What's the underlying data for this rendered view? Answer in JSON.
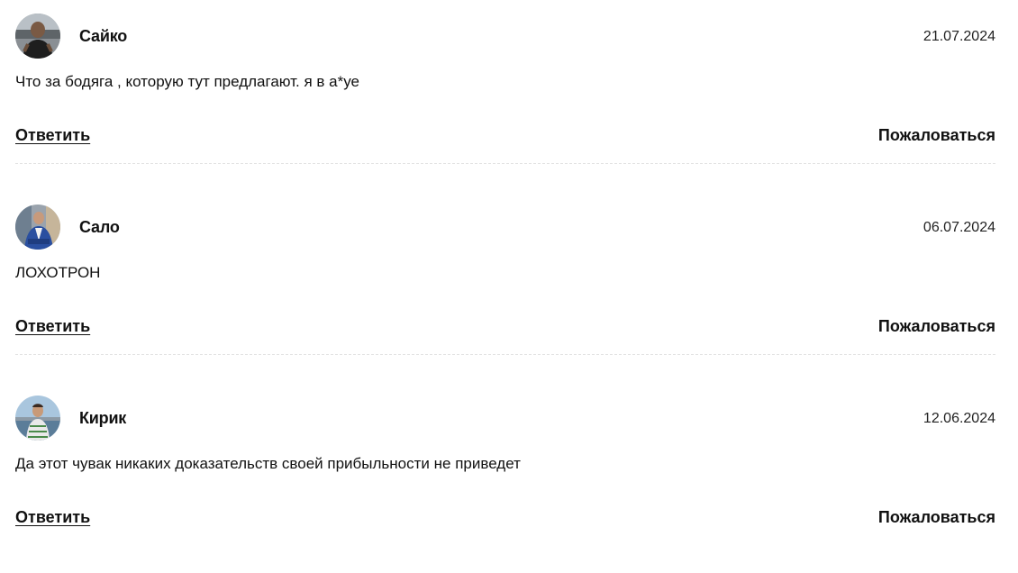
{
  "comments": [
    {
      "author": "Сайко",
      "date": "21.07.2024",
      "text": "Что за бодяга , которую тут предлагают. я в а*уе",
      "reply_label": "Ответить",
      "report_label": "Пожаловаться"
    },
    {
      "author": "Сало",
      "date": "06.07.2024",
      "text": "ЛОХОТРОН",
      "reply_label": "Ответить",
      "report_label": "Пожаловаться"
    },
    {
      "author": "Кирик",
      "date": "12.06.2024",
      "text": "Да этот чувак никаких доказательств своей прибыльности не приведет",
      "reply_label": "Ответить",
      "report_label": "Пожаловаться"
    }
  ]
}
